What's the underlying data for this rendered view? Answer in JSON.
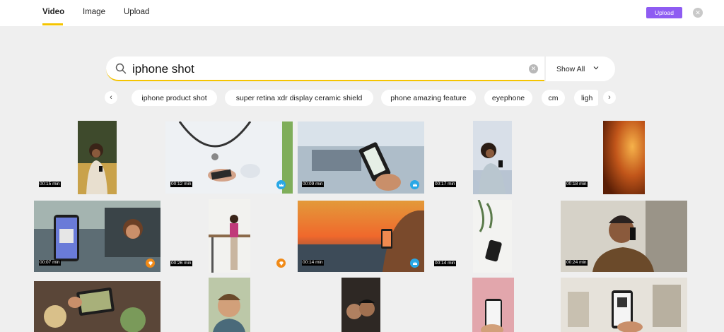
{
  "tabs": [
    {
      "label": "Video",
      "active": true
    },
    {
      "label": "Image",
      "active": false
    },
    {
      "label": "Upload",
      "active": false
    }
  ],
  "header": {
    "upload_label": "Upload"
  },
  "search": {
    "query": "iphone shot",
    "filter_label": "Show All"
  },
  "chips": [
    "iphone product shot",
    "super retina xdr display ceramic shield",
    "phone amazing feature",
    "eyephone",
    "cm",
    "ligh"
  ],
  "colors": {
    "accent": "#f5c400",
    "upload": "#8e5cf2",
    "badge_blue": "#2aa8e6",
    "badge_orange": "#f08a17"
  },
  "results": [
    {
      "duration": "00:15 min",
      "subject": "woman on couch with phone"
    },
    {
      "duration": "00:12 min",
      "subject": "doctor with stethoscope using phone",
      "badge": "crown-icon"
    },
    {
      "duration": "00:09 min",
      "subject": "airport QR code scan",
      "badge": "crown-icon"
    },
    {
      "duration": "00:17 min",
      "subject": "woman lying in bed with phone"
    },
    {
      "duration": "00:18 min",
      "subject": "orange abstract"
    },
    {
      "duration": "00:07 min",
      "subject": "woman in car showing QR code"
    },
    {
      "duration": "00:26 min",
      "subject": "woman at standing desk",
      "badge": "diamond-icon"
    },
    {
      "duration": "00:14 min",
      "subject": "sunset photo with phone",
      "badge": "crown-icon"
    },
    {
      "duration": "00:14 min",
      "subject": "phone on desk with plant"
    },
    {
      "duration": "00:24 min",
      "subject": "man on phone call"
    },
    {
      "subject": "people photographing food"
    },
    {
      "subject": "smiling man"
    },
    {
      "subject": "couple selfie"
    },
    {
      "subject": "hand holding phone on pink"
    },
    {
      "subject": "phone with QR code in room"
    }
  ]
}
